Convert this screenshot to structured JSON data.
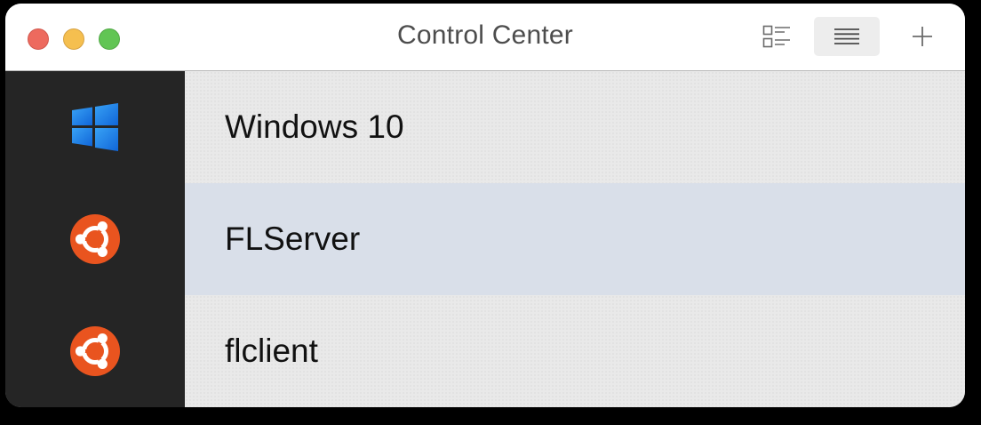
{
  "window": {
    "title": "Control Center",
    "traffic_lights": {
      "close_color": "#ed6a5e",
      "minimize_color": "#f5bf4f",
      "maximize_color": "#61c554"
    },
    "toolbar": {
      "grid_view_icon": "grid-view-icon",
      "list_view_icon": "list-view-icon",
      "list_view_active": true,
      "add_icon": "plus-icon"
    }
  },
  "vms": [
    {
      "name": "Windows 10",
      "os_icon": "windows-logo-icon",
      "selected": false
    },
    {
      "name": "FLServer",
      "os_icon": "ubuntu-logo-icon",
      "selected": true
    },
    {
      "name": "flclient",
      "os_icon": "ubuntu-logo-icon",
      "selected": false
    }
  ],
  "colors": {
    "sidebar": "#252525",
    "row_background": "#e9e9e9",
    "selected_row": "#d9dfe9",
    "ubuntu_orange": "#e9541f",
    "windows_blue": "#1a78e8"
  }
}
